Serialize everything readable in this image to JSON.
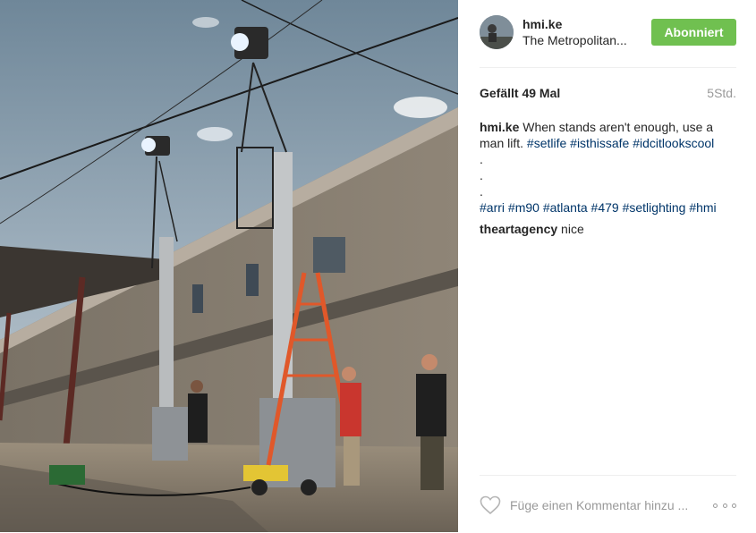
{
  "post": {
    "username": "hmi.ke",
    "location": "The Metropolitan...",
    "follow_label": "Abonniert",
    "likes": "Gefällt 49 Mal",
    "time": "5Std.",
    "caption": {
      "author": "hmi.ke",
      "text_start": "When stands aren't enough, use a man lift.",
      "tags_line1": [
        "#setlife",
        "#isthissafe",
        "#idcitlookscool"
      ],
      "dots": [
        ".",
        ".",
        "."
      ],
      "tags_line2": [
        "#arri",
        "#m90",
        "#atlanta",
        "#479",
        "#setlighting",
        "#hmi"
      ]
    },
    "comments": [
      {
        "author": "theartagency",
        "text": "nice"
      }
    ],
    "comment_placeholder": "Füge einen Kommentar hinzu ..."
  },
  "icons": {
    "like": "heart-outline-icon",
    "more": "three-dots-icon"
  },
  "colors": {
    "follow_button": "#70c050",
    "hashtag": "#003569",
    "secondary_text": "#999999",
    "divider": "#efefef"
  }
}
